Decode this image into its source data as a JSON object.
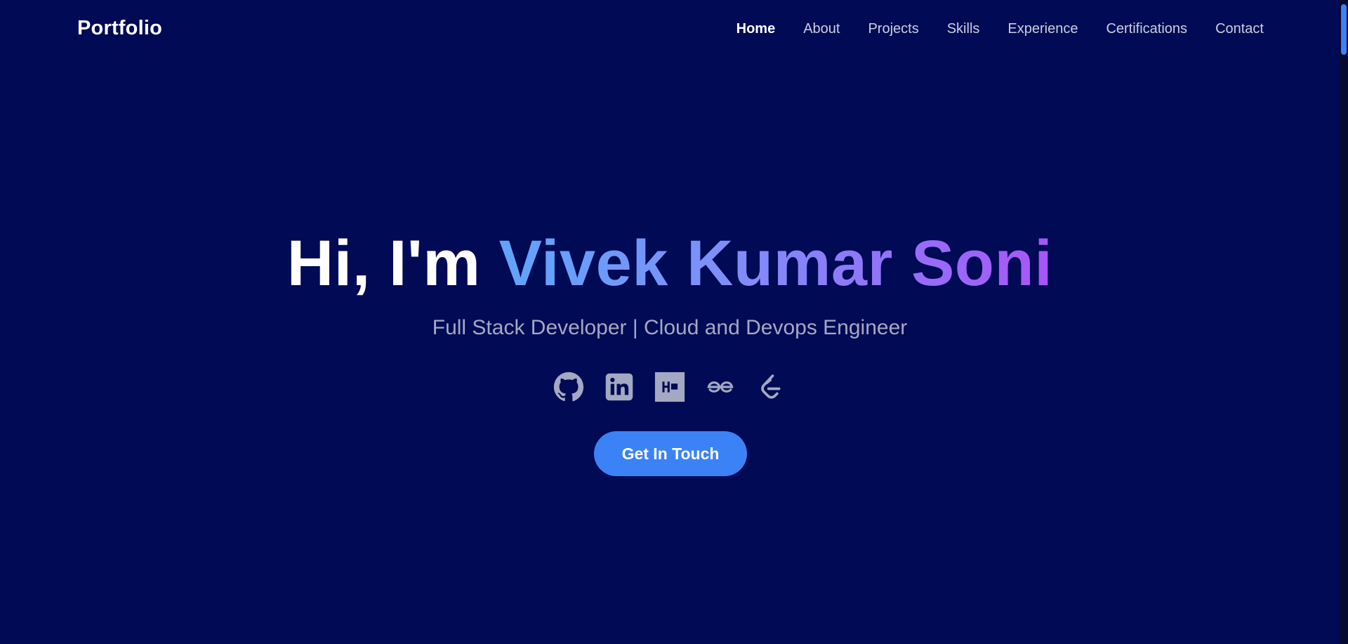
{
  "brand": "Portfolio",
  "nav": {
    "items": [
      {
        "label": "Home",
        "active": true
      },
      {
        "label": "About"
      },
      {
        "label": "Projects"
      },
      {
        "label": "Skills"
      },
      {
        "label": "Experience"
      },
      {
        "label": "Certifications"
      },
      {
        "label": "Contact"
      }
    ]
  },
  "hero": {
    "greeting": "Hi, I'm",
    "name": "Vivek Kumar Soni",
    "subtitle": "Full Stack Developer | Cloud and Devops Engineer",
    "cta_label": "Get In Touch"
  },
  "socials": [
    {
      "icon": "github-icon"
    },
    {
      "icon": "linkedin-icon"
    },
    {
      "icon": "hackerrank-icon"
    },
    {
      "icon": "geeksforgeeks-icon"
    },
    {
      "icon": "leetcode-icon"
    }
  ],
  "colors": {
    "background": "#010a55",
    "accent": "#3b82f6",
    "gradient_start": "#60a5fa",
    "gradient_end": "#a855f7",
    "icon": "#a3a9c2"
  }
}
